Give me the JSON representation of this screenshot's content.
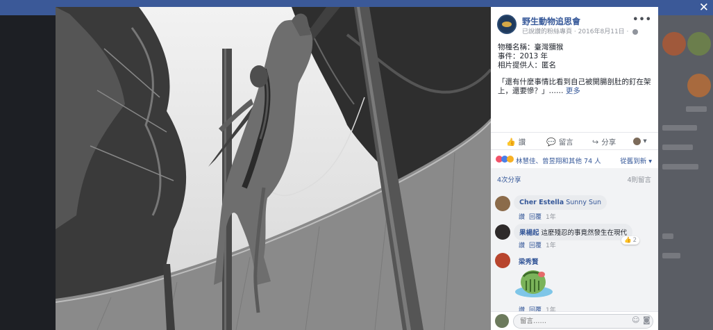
{
  "window": {
    "close_label": "✕"
  },
  "photo": {
    "description_icon": "monkey-photo"
  },
  "post": {
    "page_name": "野生動物追思會",
    "sub_meta": "已說讚的粉絲專頁 · 2016年8月11日 ·",
    "more_label": "•••",
    "lines": [
      "物種名稱：臺灣獼猴",
      "事件：2013 年",
      "相片提供人：匿名"
    ],
    "quote_line1": "「還有什麼事情比看到自己被開腸剖肚的釘在架",
    "quote_line2": "上，還要慘？」……",
    "see_more": "更多"
  },
  "actions": {
    "like": "讚",
    "comment": "留言",
    "share": "分享",
    "react_arrow": "▾"
  },
  "reactions": {
    "text": "林慧佳、曾昱翔和其他 74 人",
    "sort": "從舊到新 ▾"
  },
  "counts": {
    "shares": "4次分享",
    "comments": "4則留言"
  },
  "comments": [
    {
      "author": "Cher Estella",
      "text": "Sunny Sun",
      "like": "讚",
      "reply": "回覆",
      "time": "1年"
    },
    {
      "author": "果楊起",
      "text": "這麼殘忍的事竟然發生在現代",
      "like": "讚",
      "reply": "回覆",
      "time": "1年",
      "likes": "2"
    },
    {
      "author": "梁秀賢",
      "like": "讚",
      "reply": "回覆",
      "time": "1年"
    }
  ],
  "input": {
    "placeholder": "留言……"
  }
}
